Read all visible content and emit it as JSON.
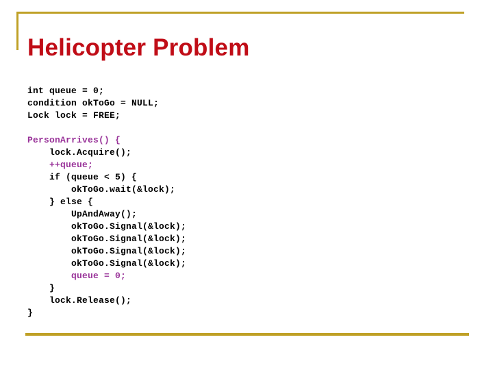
{
  "slide": {
    "title": "Helicopter Problem",
    "title_color": "#c00d17",
    "rule_color": "#bfa026",
    "background": "#ffffff"
  },
  "code": {
    "default_color": "#000000",
    "accent_color": "#993399",
    "lines": [
      {
        "text": "int queue = 0;",
        "color": "black"
      },
      {
        "text": "condition okToGo = NULL;",
        "color": "black"
      },
      {
        "text": "Lock lock = FREE;",
        "color": "black"
      },
      {
        "text": "",
        "color": "black"
      },
      {
        "text": "PersonArrives() {",
        "color": "purple"
      },
      {
        "text": "    lock.Acquire();",
        "color": "black"
      },
      {
        "text": "    ++queue;",
        "color": "purple"
      },
      {
        "text": "    if (queue < 5) {",
        "color": "black"
      },
      {
        "text": "        okToGo.wait(&lock);",
        "color": "black"
      },
      {
        "text": "    } else {",
        "color": "black"
      },
      {
        "text": "        UpAndAway();",
        "color": "black"
      },
      {
        "text": "        okToGo.Signal(&lock);",
        "color": "black"
      },
      {
        "text": "        okToGo.Signal(&lock);",
        "color": "black"
      },
      {
        "text": "        okToGo.Signal(&lock);",
        "color": "black"
      },
      {
        "text": "        okToGo.Signal(&lock);",
        "color": "black"
      },
      {
        "text": "        queue = 0;",
        "color": "purple"
      },
      {
        "text": "    }",
        "color": "black"
      },
      {
        "text": "    lock.Release();",
        "color": "black"
      },
      {
        "text": "}",
        "color": "black"
      }
    ]
  }
}
